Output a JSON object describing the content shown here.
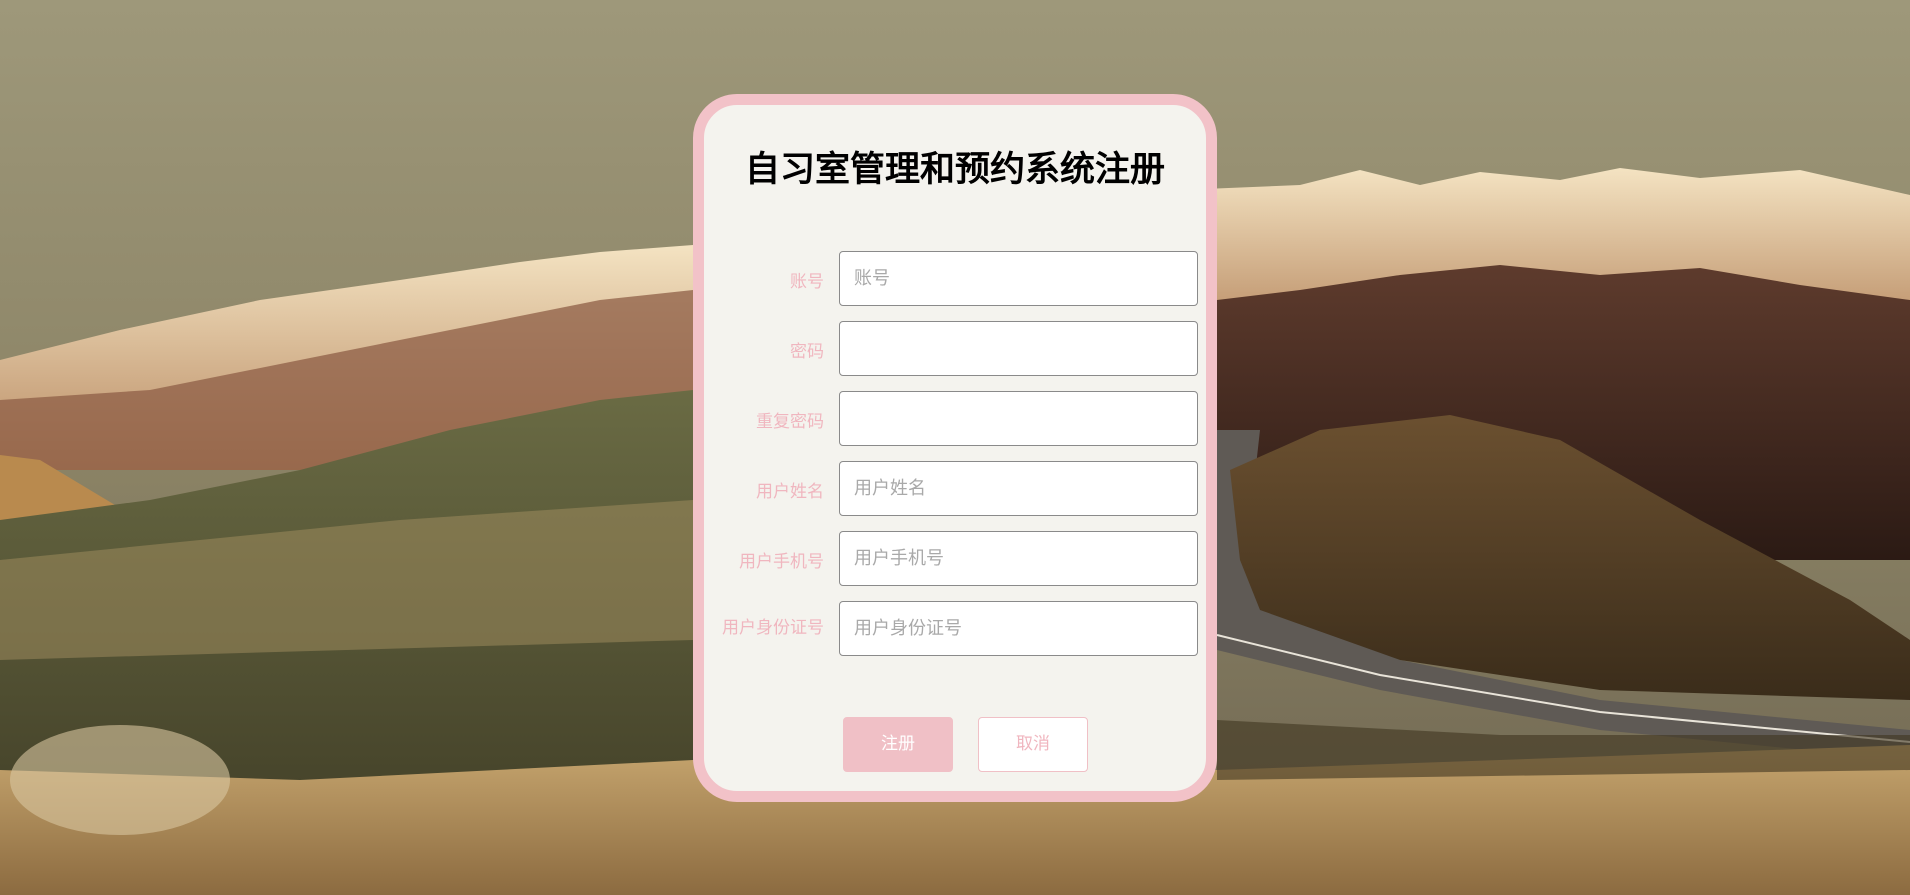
{
  "form": {
    "title": "自习室管理和预约系统注册",
    "fields": [
      {
        "label": "账号",
        "placeholder": "账号",
        "value": ""
      },
      {
        "label": "密码",
        "placeholder": "",
        "value": ""
      },
      {
        "label": "重复密码",
        "placeholder": "",
        "value": ""
      },
      {
        "label": "用户姓名",
        "placeholder": "用户姓名",
        "value": ""
      },
      {
        "label": "用户手机号",
        "placeholder": "用户手机号",
        "value": ""
      },
      {
        "label": "用户身份证号",
        "placeholder": "用户身份证号",
        "value": ""
      }
    ],
    "register_label": "注册",
    "cancel_label": "取消"
  },
  "colors": {
    "accent": "#f2c2c8",
    "label": "#f0b6bf",
    "card_bg": "#f4f3ee"
  }
}
